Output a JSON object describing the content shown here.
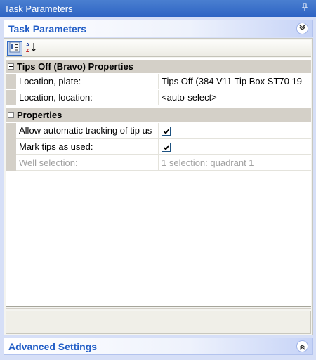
{
  "window": {
    "title": "Task Parameters",
    "pin_icon": "pin-icon"
  },
  "task_section": {
    "title": "Task Parameters",
    "collapse_icon": "double-chevron-up-icon"
  },
  "toolbar": {
    "categorized_icon": "categorized-view-icon",
    "alphabetical_icon": "sort-alphabetical-icon"
  },
  "grid": {
    "categories": [
      {
        "label": "Tips Off (Bravo) Properties",
        "rows": [
          {
            "name": "Location, plate:",
            "value": "Tips Off  (384 V11 Tip Box ST70 19"
          },
          {
            "name": "Location, location:",
            "value": "<auto-select>"
          }
        ]
      },
      {
        "label": "Properties",
        "rows": [
          {
            "name": "Allow automatic tracking of tip us",
            "value": "",
            "checked": true
          },
          {
            "name": "Mark tips as used:",
            "value": "",
            "checked": true
          },
          {
            "name": "Well selection:",
            "value": "1 selection: quadrant 1",
            "disabled": true
          }
        ]
      }
    ]
  },
  "advanced_section": {
    "title": "Advanced Settings",
    "expand_icon": "double-chevron-up-icon"
  },
  "colors": {
    "title_bar": "#2e64c4",
    "section_text": "#215dc6",
    "category_bg": "#d4d0c8",
    "frame_bg": "#d6dff7"
  }
}
